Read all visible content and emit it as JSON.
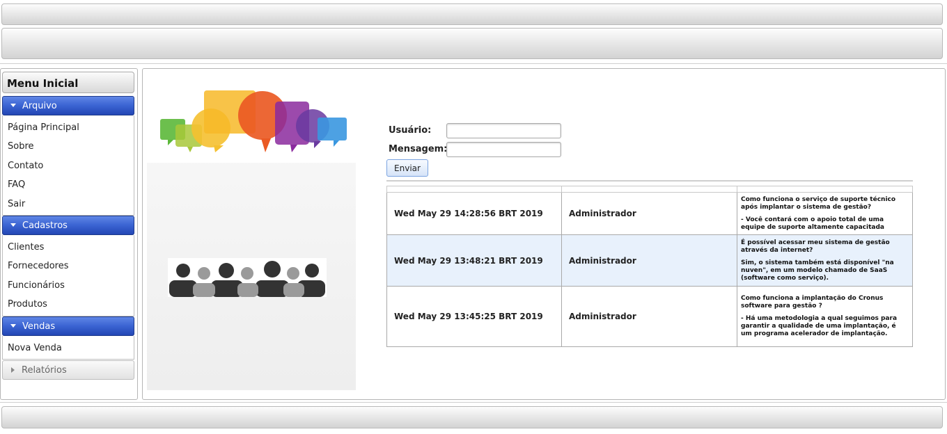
{
  "menu": {
    "title": "Menu Inicial",
    "sections": [
      {
        "label": "Arquivo",
        "items": [
          "Página Principal",
          "Sobre",
          "Contato",
          "FAQ",
          "Sair"
        ]
      },
      {
        "label": "Cadastros",
        "items": [
          "Clientes",
          "Fornecedores",
          "Funcionários",
          "Produtos"
        ]
      },
      {
        "label": "Vendas",
        "items": [
          "Nova Venda"
        ]
      }
    ],
    "collapsed": {
      "label": "Relatórios"
    }
  },
  "form": {
    "user_label": "Usuário:",
    "message_label": "Mensagem:",
    "user_value": "",
    "message_value": "",
    "submit_label": "Enviar"
  },
  "messages": [
    {
      "date": "Wed May 29 14:28:56 BRT 2019",
      "user": "Administrador",
      "question": "Como funciona o serviço de suporte técnico após implantar o sistema de gestão?",
      "answer": "- Você contará com o apoio total de uma equipe de suporte altamente capacitada"
    },
    {
      "date": "Wed May 29 13:48:21 BRT 2019",
      "user": "Administrador",
      "question": "É possível acessar meu sistema de gestão através da internet?",
      "answer": "Sim, o sistema também está disponível \"na nuven\", em um modelo chamado de SaaS (software como serviço)."
    },
    {
      "date": "Wed May 29 13:45:25 BRT 2019",
      "user": "Administrador",
      "question": "Como funciona a implantação do Cronus software para gestão ?",
      "answer": "- Há uma metodologia a qual seguimos para garantir a qualidade de uma implantação, é um programa acelerador de implantação."
    }
  ],
  "colors": {
    "menu_header": "#3a63d2",
    "alt_row": "#e8f1fc"
  }
}
